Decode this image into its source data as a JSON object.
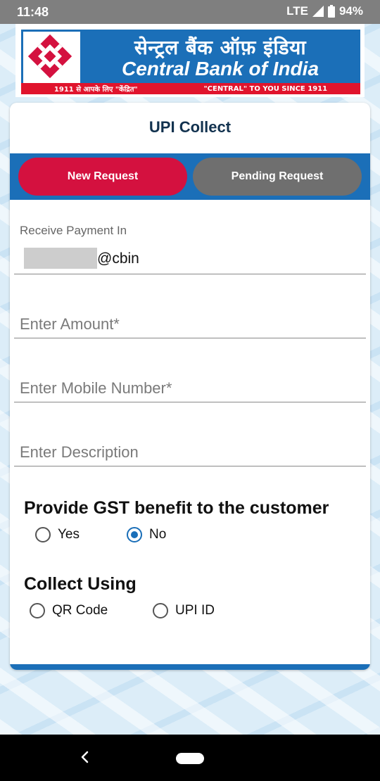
{
  "status": {
    "time": "11:48",
    "network": "LTE",
    "battery": "94%"
  },
  "header": {
    "bank_name_hindi": "सेन्ट्रल बैंक ऑफ़ इंडिया",
    "bank_name_english": "Central Bank of India",
    "tagline_left": "1911 से आपके लिए \"केंद्रित\"",
    "tagline_right": "\"CENTRAL\" TO YOU SINCE 1911",
    "brand_colors": {
      "blue": "#1b6fb8",
      "red": "#e0142d"
    }
  },
  "card": {
    "title": "UPI Collect",
    "tabs": [
      {
        "label": "New Request",
        "active": true
      },
      {
        "label": "Pending Request",
        "active": false
      }
    ],
    "receive": {
      "label": "Receive Payment In",
      "value": "@cbin"
    },
    "amount": {
      "placeholder": "Enter Amount*"
    },
    "mobile": {
      "placeholder": "Enter Mobile Number*"
    },
    "description": {
      "placeholder": "Enter Description"
    },
    "gst": {
      "title": "Provide GST benefit to the customer",
      "options": [
        {
          "label": "Yes",
          "selected": false
        },
        {
          "label": "No",
          "selected": true
        }
      ]
    },
    "collect": {
      "title": "Collect Using",
      "options": [
        {
          "label": "QR Code",
          "selected": false
        },
        {
          "label": "UPI ID",
          "selected": false
        }
      ]
    }
  },
  "nav": {
    "back_icon": "back-icon",
    "home_icon": "home-pill-icon"
  }
}
